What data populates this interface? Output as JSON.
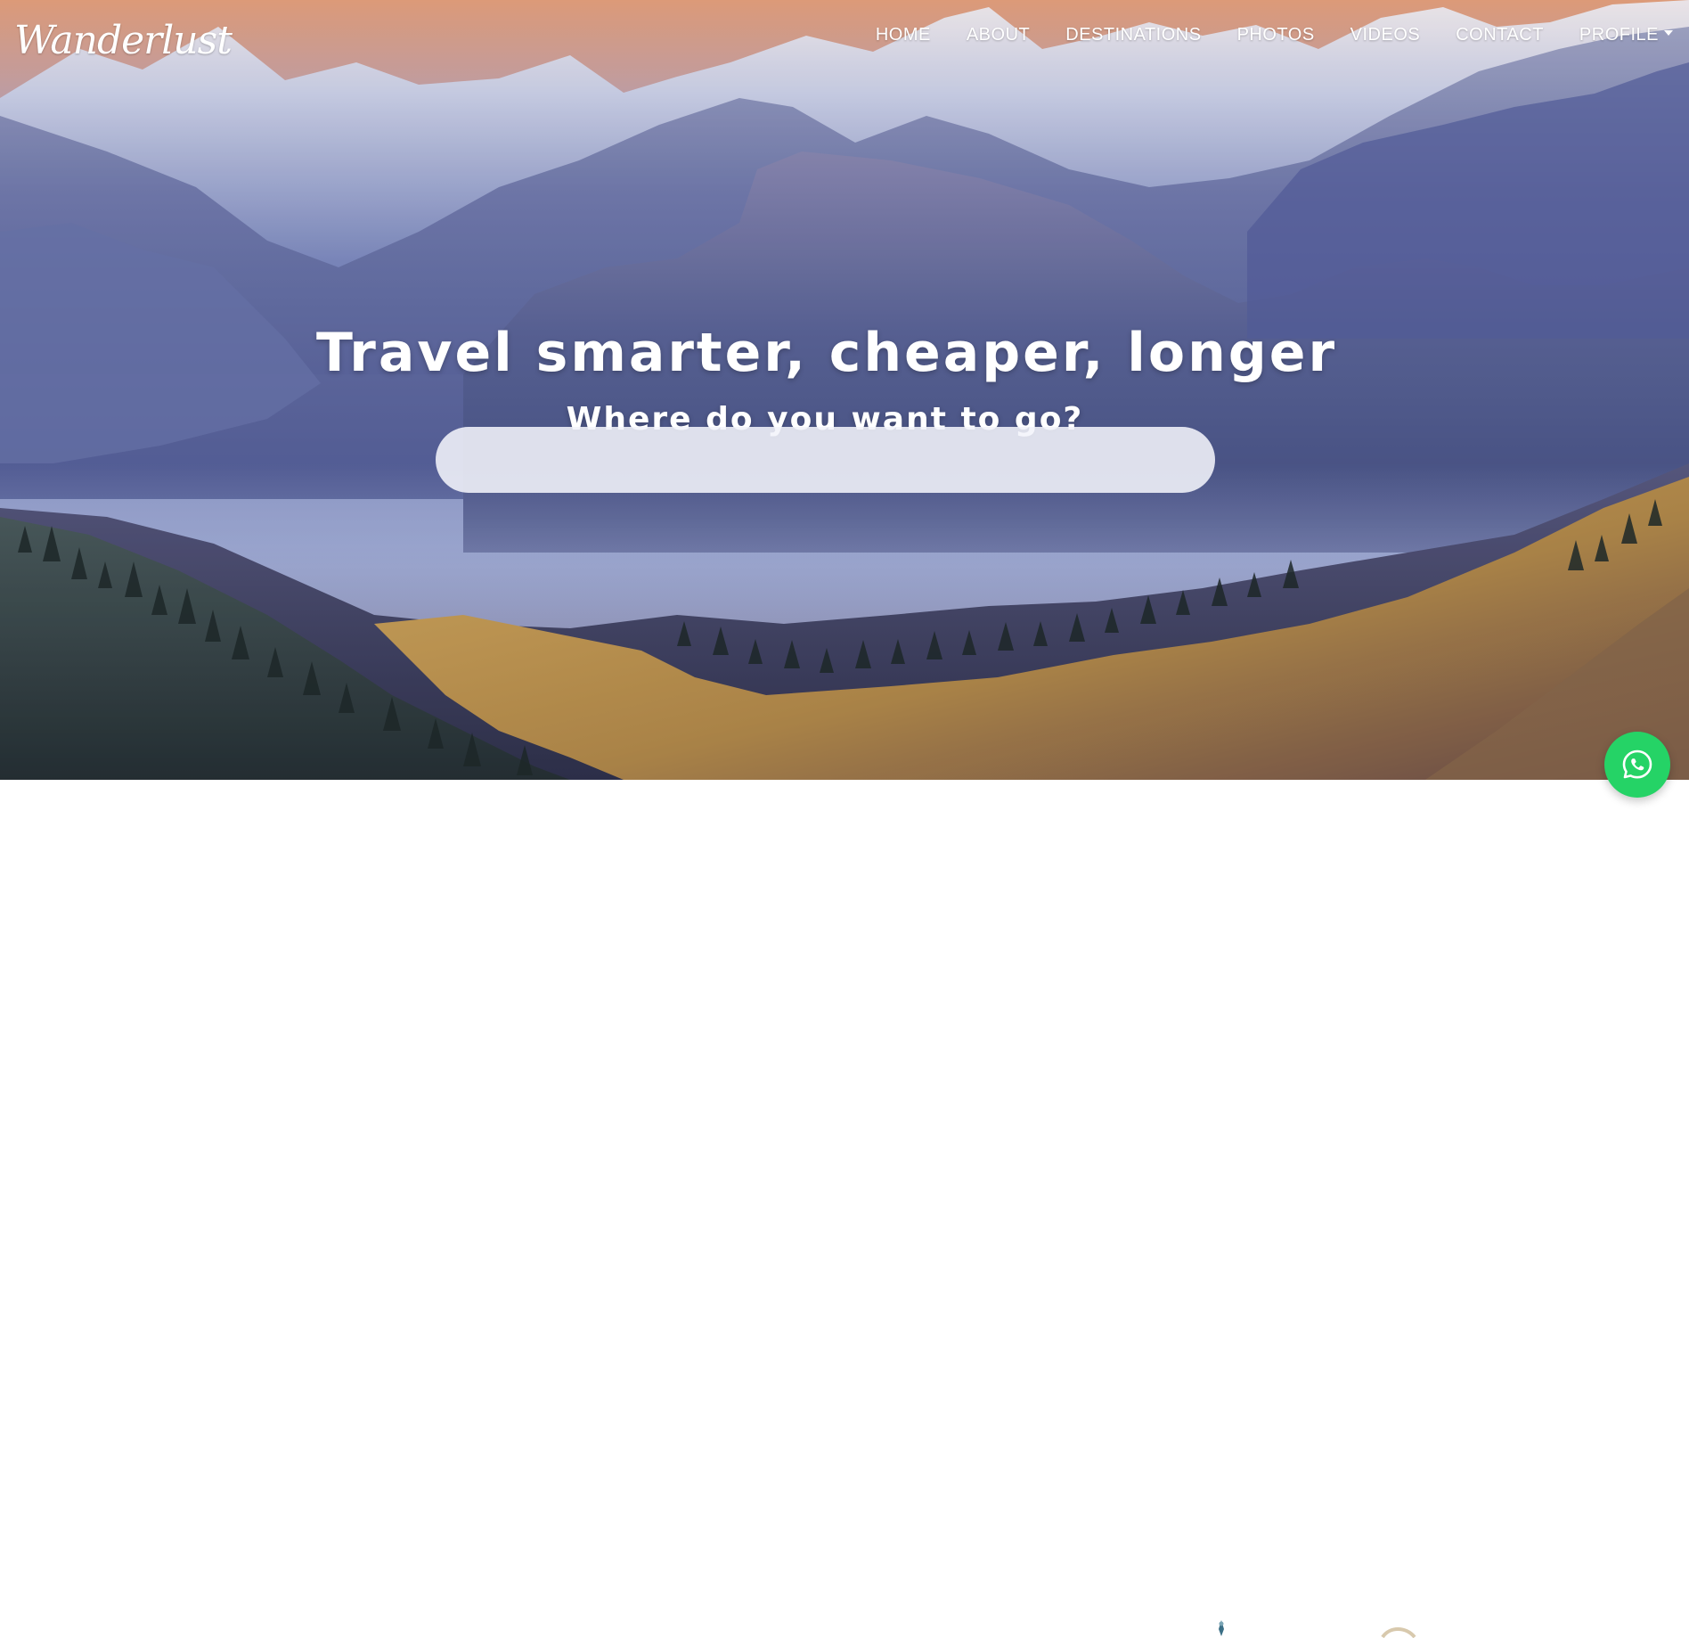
{
  "header": {
    "logo_text": "Wanderlust",
    "nav_items": [
      {
        "label": "HOME"
      },
      {
        "label": "ABOUT"
      },
      {
        "label": "DESTINATIONS"
      },
      {
        "label": "PHOTOS"
      },
      {
        "label": "VIDEOS"
      },
      {
        "label": "CONTACT"
      },
      {
        "label": "PROFILE",
        "has_dropdown": true
      }
    ]
  },
  "hero": {
    "title": "Travel smarter, cheaper, longer",
    "subtitle": "Where do you want to go?",
    "search": {
      "value": "",
      "placeholder": ""
    },
    "background": "mountain-landscape-photo"
  },
  "floating": {
    "whatsapp_icon": "whatsapp-icon",
    "accent_color": "#25d366"
  }
}
